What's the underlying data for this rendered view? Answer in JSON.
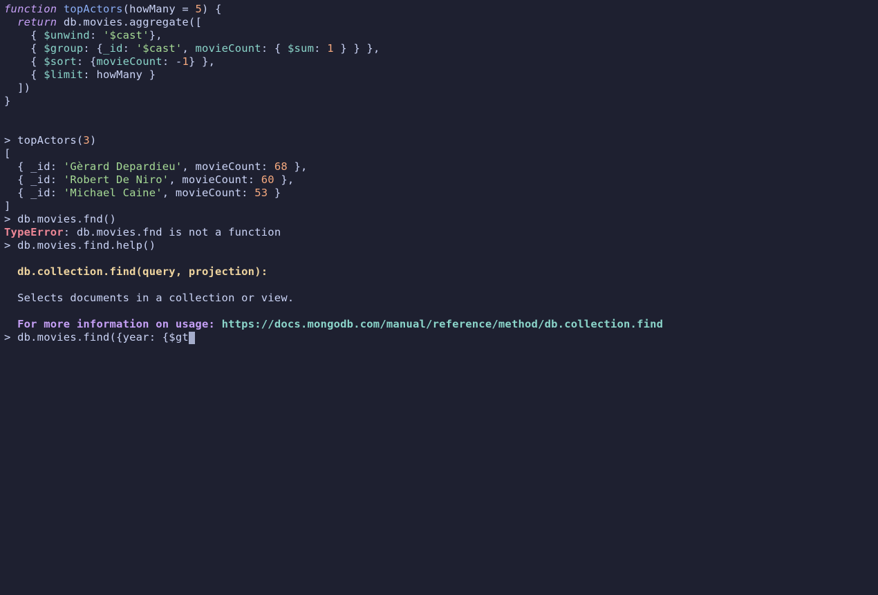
{
  "fnDecl": {
    "kwFunction": "function",
    "name": "topActors",
    "paramName": "howMany",
    "eq": " = ",
    "defaultVal": "5",
    "open": ") {"
  },
  "line2": {
    "kwReturn": "return",
    "rest": " db.movies.aggregate(["
  },
  "line3": {
    "open": "    { ",
    "op": "$unwind",
    "mid": ": ",
    "str": "'$cast'",
    "close": "},"
  },
  "line4": {
    "open": "    { ",
    "op": "$group",
    "mid1": ": {",
    "idKey": "_id",
    "mid2": ": ",
    "str": "'$cast'",
    "mid3": ", ",
    "movieCount": "movieCount",
    "mid4": ": { ",
    "sum": "$sum",
    "mid5": ": ",
    "num": "1",
    "close": " } } },"
  },
  "line5": {
    "open": "    { ",
    "op": "$sort",
    "mid1": ": {",
    "movieCount": "movieCount",
    "mid2": ": ",
    "neg": "-",
    "num": "1",
    "close": "} },"
  },
  "line6": {
    "open": "    { ",
    "op": "$limit",
    "mid": ": howMany }"
  },
  "line7": "  ])",
  "line8": "}",
  "call": {
    "prompt": "> ",
    "fn": "topActors(",
    "arg": "3",
    "close": ")"
  },
  "resultOpen": "[",
  "r1": {
    "pre": "  { _id: ",
    "name": "'Gèrard Depardieu'",
    "mid": ", movieCount: ",
    "num": "68",
    "post": " },"
  },
  "r2": {
    "pre": "  { _id: ",
    "name": "'Robert De Niro'",
    "mid": ", movieCount: ",
    "num": "60",
    "post": " },"
  },
  "r3": {
    "pre": "  { _id: ",
    "name": "'Michael Caine'",
    "mid": ", movieCount: ",
    "num": "53",
    "post": " }"
  },
  "resultClose": "]",
  "fndCall": {
    "prompt": "> ",
    "text": "db.movies.fnd()"
  },
  "err": {
    "label": "TypeError",
    "msg": ": db.movies.fnd is not a function"
  },
  "helpCall": {
    "prompt": "> ",
    "text": "db.movies.find.help()"
  },
  "helpHeading": "  db.collection.find(query, projection):",
  "helpDesc": "  Selects documents in a collection or view.",
  "helpMore": {
    "label": "  For more information on usage: ",
    "url": "https://docs.mongodb.com/manual/reference/method/db.collection.find"
  },
  "input": {
    "prompt": "> ",
    "text": "db.movies.find({year: {$gt"
  }
}
